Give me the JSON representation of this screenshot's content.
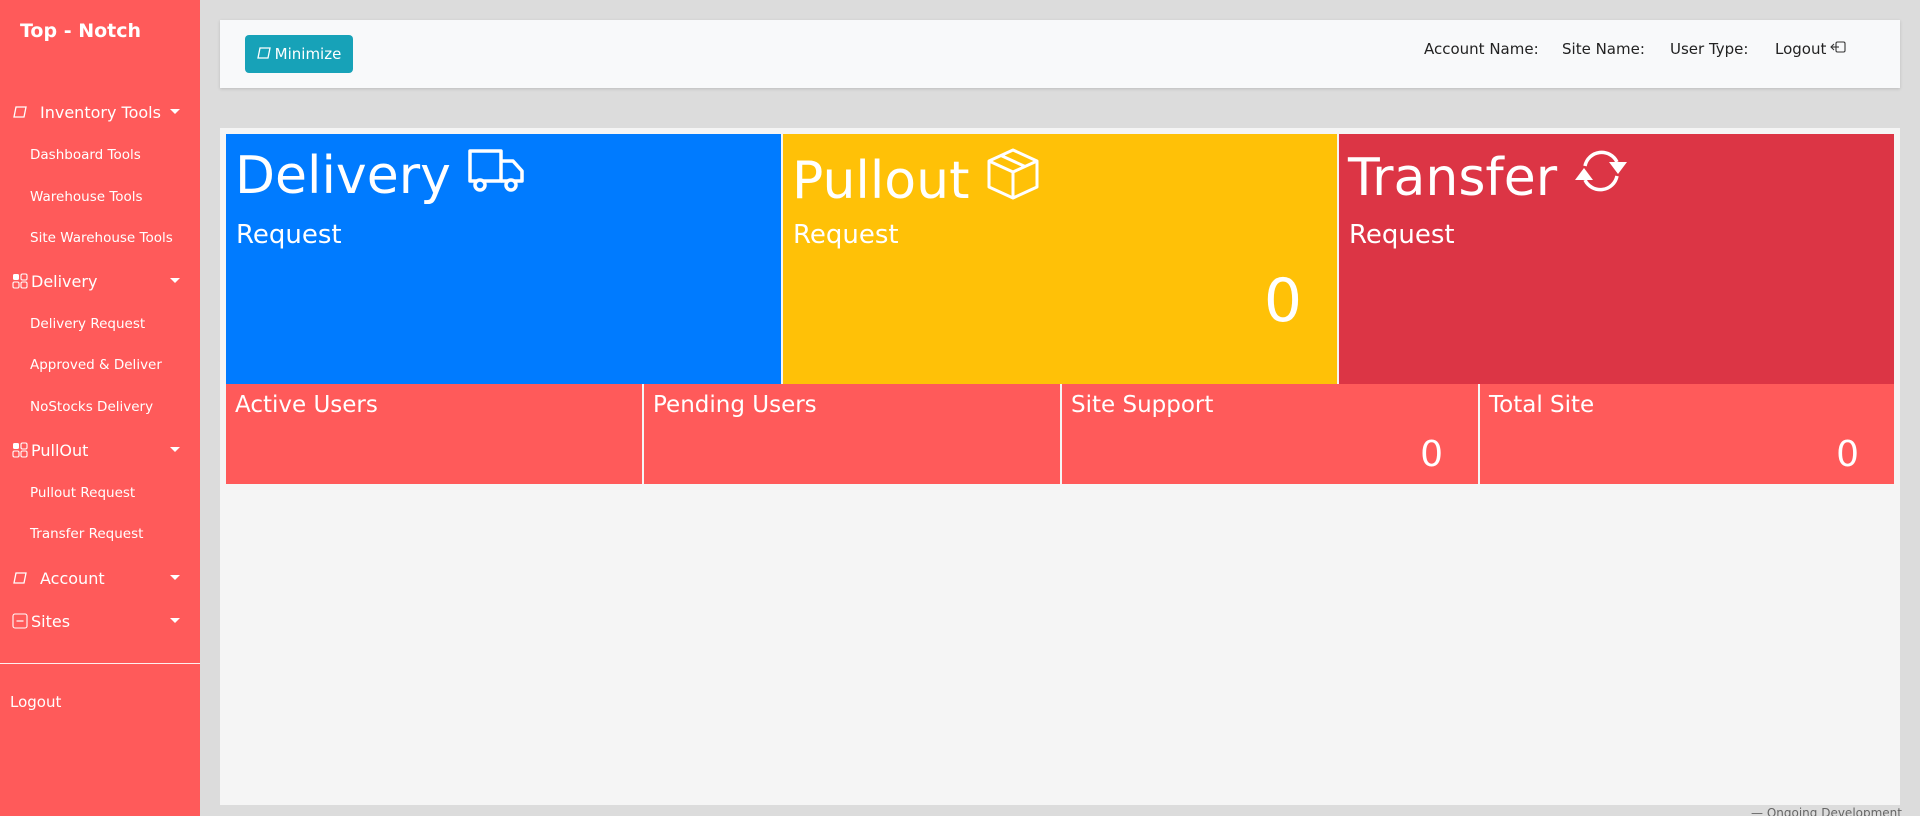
{
  "sidebar": {
    "brand": "Top - Notch",
    "groups": [
      {
        "label": "Inventory Tools",
        "icon": "square-outline-icon",
        "items": [
          "Dashboard Tools",
          "Warehouse Tools",
          "Site Warehouse Tools"
        ]
      },
      {
        "label": "Delivery",
        "icon": "grid-check-icon",
        "items": [
          "Delivery Request",
          "Approved & Deliver",
          "NoStocks Delivery"
        ]
      },
      {
        "label": "PullOut",
        "icon": "grid-check-icon",
        "items": [
          "Pullout Request",
          "Transfer Request"
        ]
      },
      {
        "label": "Account",
        "icon": "square-outline-icon",
        "items": []
      },
      {
        "label": "Sites",
        "icon": "minus-square-icon",
        "items": []
      }
    ],
    "logout": "Logout"
  },
  "header": {
    "minimize_label": "Minimize",
    "account_name_label": "Account Name:",
    "site_name_label": "Site Name:",
    "user_type_label": "User Type:",
    "logout_label": "Logout"
  },
  "cards": {
    "delivery": {
      "title": "Delivery",
      "subtitle": "Request",
      "count": "",
      "color": "#007bff",
      "icon": "truck-icon"
    },
    "pullout": {
      "title": "Pullout",
      "subtitle": "Request",
      "count": "0",
      "color": "#ffc107",
      "icon": "box-icon"
    },
    "transfer": {
      "title": "Transfer",
      "subtitle": "Request",
      "count": "",
      "color": "#dc3545",
      "icon": "refresh-icon"
    }
  },
  "stats": [
    {
      "label": "Active Users",
      "count": ""
    },
    {
      "label": "Pending Users",
      "count": ""
    },
    {
      "label": "Site Support",
      "count": "0"
    },
    {
      "label": "Total Site",
      "count": "0"
    }
  ],
  "footer_note": "— Ongoing Development",
  "colors": {
    "sidebar": "#ff5a5a",
    "button": "#17a2b8",
    "stat_card": "#ff5a5a"
  }
}
